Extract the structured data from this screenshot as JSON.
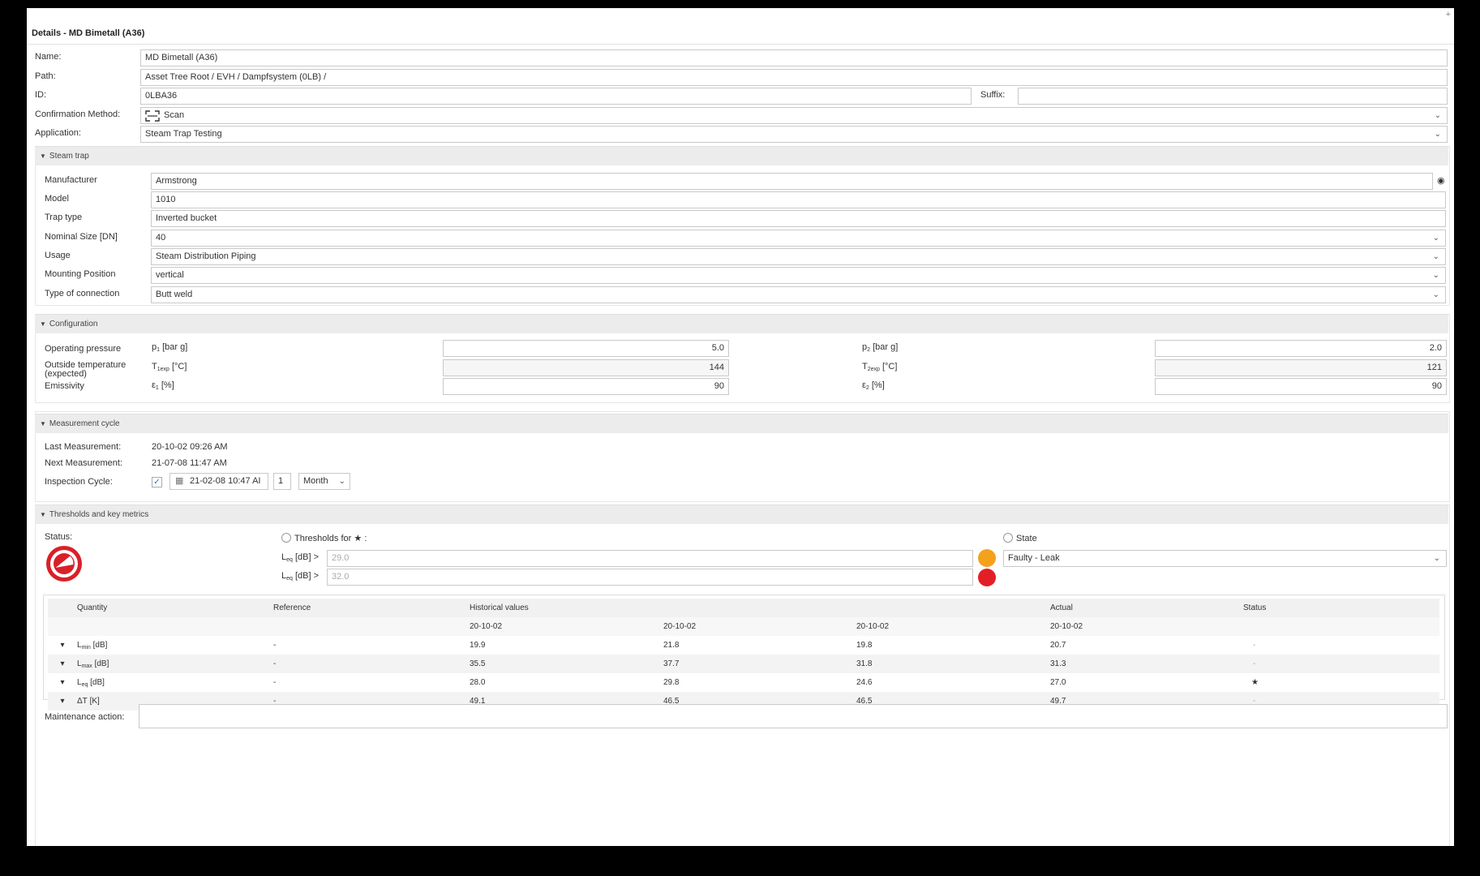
{
  "window": {
    "title": "Details - MD Bimetall (A36)"
  },
  "details": {
    "name_label": "Name:",
    "name_value": "MD Bimetall (A36)",
    "path_label": "Path:",
    "path_value": "Asset Tree Root / EVH / Dampfsystem (0LB) /",
    "id_label": "ID:",
    "id_value": "0LBA36",
    "suffix_label": "Suffix:",
    "suffix_value": "",
    "confirmation_label": "Confirmation Method:",
    "confirmation_value": "Scan",
    "application_label": "Application:",
    "application_value": "Steam Trap Testing"
  },
  "steam_trap": {
    "header": "Steam trap",
    "fields": [
      {
        "label": "Manufacturer",
        "value": "Armstrong"
      },
      {
        "label": "Model",
        "value": "1010"
      },
      {
        "label": "Trap type",
        "value": "Inverted bucket"
      },
      {
        "label": "Nominal Size [DN]",
        "value": "40"
      },
      {
        "label": "Usage",
        "value": "Steam Distribution Piping"
      },
      {
        "label": "Mounting Position",
        "value": "vertical"
      },
      {
        "label": "Type of connection",
        "value": "Butt weld"
      }
    ]
  },
  "configuration": {
    "header": "Configuration",
    "operating_pressure_label": "Operating pressure",
    "outside_temperature_label_1": "Outside temperature",
    "outside_temperature_label_2": "(expected)",
    "emissivity_label": "Emissivity",
    "p1_symbol": "p",
    "p1_sub": "1",
    "p1_unit": " [bar g]",
    "p1_value": "5.0",
    "p2_symbol": "p",
    "p2_sub": "2",
    "p2_unit": " [bar g]",
    "p2_value": "2.0",
    "t1_symbol": "T",
    "t1_sub": "1exp",
    "t1_unit": " [°C]",
    "t1_value": "144",
    "t2_symbol": "T",
    "t2_sub": "2exp",
    "t2_unit": " [°C]",
    "t2_value": "121",
    "e1_symbol": "ε",
    "e1_sub": "1",
    "e1_unit": " [%]",
    "e1_value": "90",
    "e2_symbol": "ε",
    "e2_sub": "2",
    "e2_unit": " [%]",
    "e2_value": "90"
  },
  "measurement_cycle": {
    "header": "Measurement cycle",
    "last_label": "Last Measurement:",
    "last_value": "20-10-02 09:26 AM",
    "next_label": "Next Measurement:",
    "next_value": "21-07-08 11:47 AM",
    "inspection_label": "Inspection Cycle:",
    "inspection_checked": true,
    "inspection_date": "21-02-08 10:47 AI",
    "inspection_count": "1",
    "inspection_unit": "Month"
  },
  "thresholds": {
    "header": "Thresholds and key metrics",
    "status_label": "Status:",
    "thresholds_for_label": "Thresholds for",
    "thresholds_for_suffix": ":",
    "leq_symbol": "L",
    "leq_sub": "eq",
    "leq_unit": " [dB] >",
    "threshold_1_placeholder": "29.0",
    "threshold_2_placeholder": "32.0",
    "state_label": "State",
    "state_value": "Faulty - Leak",
    "colors": {
      "warning": "#f4a21c",
      "alarm": "#e21f26",
      "status_ring": "#d92029"
    }
  },
  "metrics_table": {
    "headers": [
      "Quantity",
      "Reference",
      "Historical values",
      "Actual",
      "Status"
    ],
    "dates": [
      "20-10-02",
      "20-10-02",
      "20-10-02",
      "20-10-02"
    ],
    "rows": [
      {
        "sym": "L",
        "sub": "min",
        "unit": " [dB]",
        "reference": "-",
        "h1": "19.9",
        "h2": "21.8",
        "h3": "19.8",
        "actual": "20.7",
        "status": "-"
      },
      {
        "sym": "L",
        "sub": "max",
        "unit": " [dB]",
        "reference": "-",
        "h1": "35.5",
        "h2": "37.7",
        "h3": "31.8",
        "actual": "31.3",
        "status": "-"
      },
      {
        "sym": "L",
        "sub": "eq",
        "unit": " [dB]",
        "reference": "-",
        "h1": "28.0",
        "h2": "29.8",
        "h3": "24.6",
        "actual": "27.0",
        "status": "★"
      },
      {
        "sym": "ΔT",
        "sub": "",
        "unit": " [K]",
        "reference": "-",
        "h1": "49.1",
        "h2": "46.5",
        "h3": "46.5",
        "actual": "49.7",
        "status": "-"
      }
    ]
  },
  "maintenance": {
    "label": "Maintenance action:",
    "value": ""
  }
}
